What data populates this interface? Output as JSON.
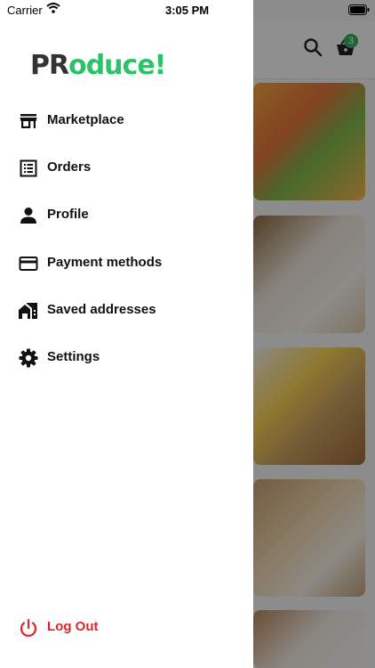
{
  "status_bar": {
    "carrier": "Carrier",
    "time": "3:05 PM"
  },
  "app": {
    "logo_dark": "PR",
    "logo_green": "oduce!"
  },
  "background": {
    "cart_count": "3"
  },
  "menu": [
    {
      "label": "Marketplace",
      "icon": "store-icon"
    },
    {
      "label": "Orders",
      "icon": "list-icon"
    },
    {
      "label": "Profile",
      "icon": "person-icon"
    },
    {
      "label": "Payment methods",
      "icon": "credit-card-icon"
    },
    {
      "label": "Saved addresses",
      "icon": "home-icon"
    },
    {
      "label": "Settings",
      "icon": "gear-icon"
    }
  ],
  "logout": {
    "label": "Log Out",
    "color": "#e0242b",
    "icon": "power-icon"
  },
  "colors": {
    "brand_green": "#29c36a",
    "badge_green": "#2fae5a"
  }
}
